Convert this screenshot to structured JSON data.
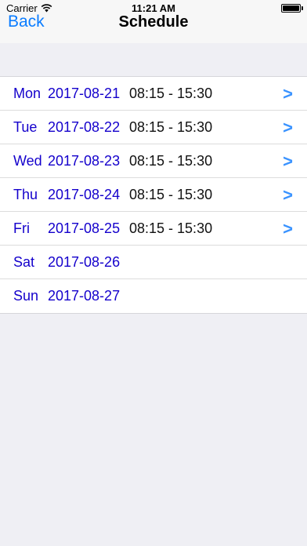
{
  "status_bar": {
    "carrier": "Carrier",
    "time": "11:21 AM",
    "wifi_icon": "wifi-icon",
    "battery_icon": "battery-icon"
  },
  "nav": {
    "back_label": "Back",
    "title": "Schedule"
  },
  "schedule": [
    {
      "day": "Mon",
      "date": "2017-08-21",
      "time": "08:15 - 15:30",
      "chevron": ">"
    },
    {
      "day": "Tue",
      "date": "2017-08-22",
      "time": "08:15 - 15:30",
      "chevron": ">"
    },
    {
      "day": "Wed",
      "date": "2017-08-23",
      "time": "08:15 - 15:30",
      "chevron": ">"
    },
    {
      "day": "Thu",
      "date": "2017-08-24",
      "time": "08:15 - 15:30",
      "chevron": ">"
    },
    {
      "day": "Fri",
      "date": "2017-08-25",
      "time": "08:15 - 15:30",
      "chevron": ">"
    },
    {
      "day": "Sat",
      "date": "2017-08-26",
      "time": "",
      "chevron": ""
    },
    {
      "day": "Sun",
      "date": "2017-08-27",
      "time": "",
      "chevron": ""
    }
  ],
  "colors": {
    "day_text": "#1400cc",
    "accent": "#0a7cff",
    "chevron": "#3a93ff",
    "background": "#efeff4"
  }
}
